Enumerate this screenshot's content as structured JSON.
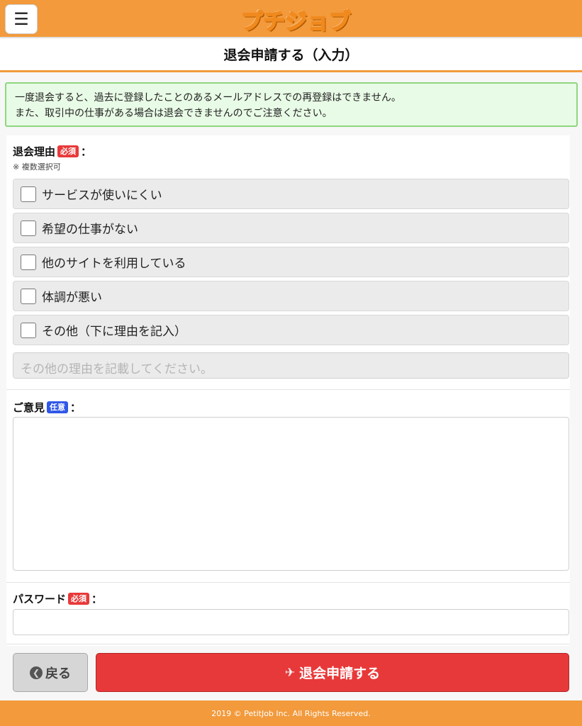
{
  "header": {
    "menu_icon": "hamburger-icon",
    "menu_glyph": "☰",
    "logo_text": "プチジョブ"
  },
  "page": {
    "title": "退会申請する（入力）"
  },
  "notice": {
    "line1": "一度退会すると、過去に登録したことのあるメールアドレスでの再登録はできません。",
    "line2": "また、取引中の仕事がある場合は退会できませんのでご注意ください。"
  },
  "form": {
    "reason": {
      "label": "退会理由",
      "badge": "必須",
      "colon": "：",
      "note": "※ 複数選択可",
      "options": [
        "サービスが使いにくい",
        "希望の仕事がない",
        "他のサイトを利用している",
        "体調が悪い",
        "その他（下に理由を記入）"
      ],
      "other_placeholder": "その他の理由を記載してください。"
    },
    "opinion": {
      "label": "ご意見",
      "badge": "任意",
      "colon": "："
    },
    "password": {
      "label": "パスワード",
      "badge": "必須",
      "colon": "："
    }
  },
  "buttons": {
    "back_label": "戻る",
    "back_icon": "chevron-left-circle-icon",
    "back_glyph": "❮",
    "submit_label": "退会申請する",
    "submit_icon": "plane-icon",
    "submit_glyph": "✈"
  },
  "footer": {
    "copyright": "2019 © PetitJob Inc. All Rights Reserved."
  },
  "colors": {
    "brand_orange": "#f29a3c",
    "danger_red": "#e8393a",
    "optional_blue": "#2f57e8",
    "notice_green": "#8ed77f"
  }
}
